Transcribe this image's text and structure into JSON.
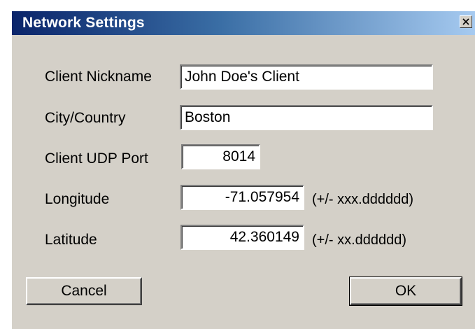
{
  "window": {
    "title": "Network Settings",
    "close_icon": "close-icon"
  },
  "form": {
    "nickname": {
      "label": "Client Nickname",
      "value": "John Doe's Client"
    },
    "city": {
      "label": "City/Country",
      "value": "Boston"
    },
    "udp_port": {
      "label": "Client UDP Port",
      "value": "8014"
    },
    "longitude": {
      "label": "Longitude",
      "value": "-71.057954",
      "hint": "(+/- xxx.dddddd)"
    },
    "latitude": {
      "label": "Latitude",
      "value": "42.360149",
      "hint": "(+/- xx.dddddd)"
    }
  },
  "buttons": {
    "cancel_label": "Cancel",
    "ok_label": "OK"
  },
  "colors": {
    "titlebar_start": "#0a246a",
    "titlebar_end": "#a6caf0",
    "dialog_background": "#d4d0c8"
  }
}
